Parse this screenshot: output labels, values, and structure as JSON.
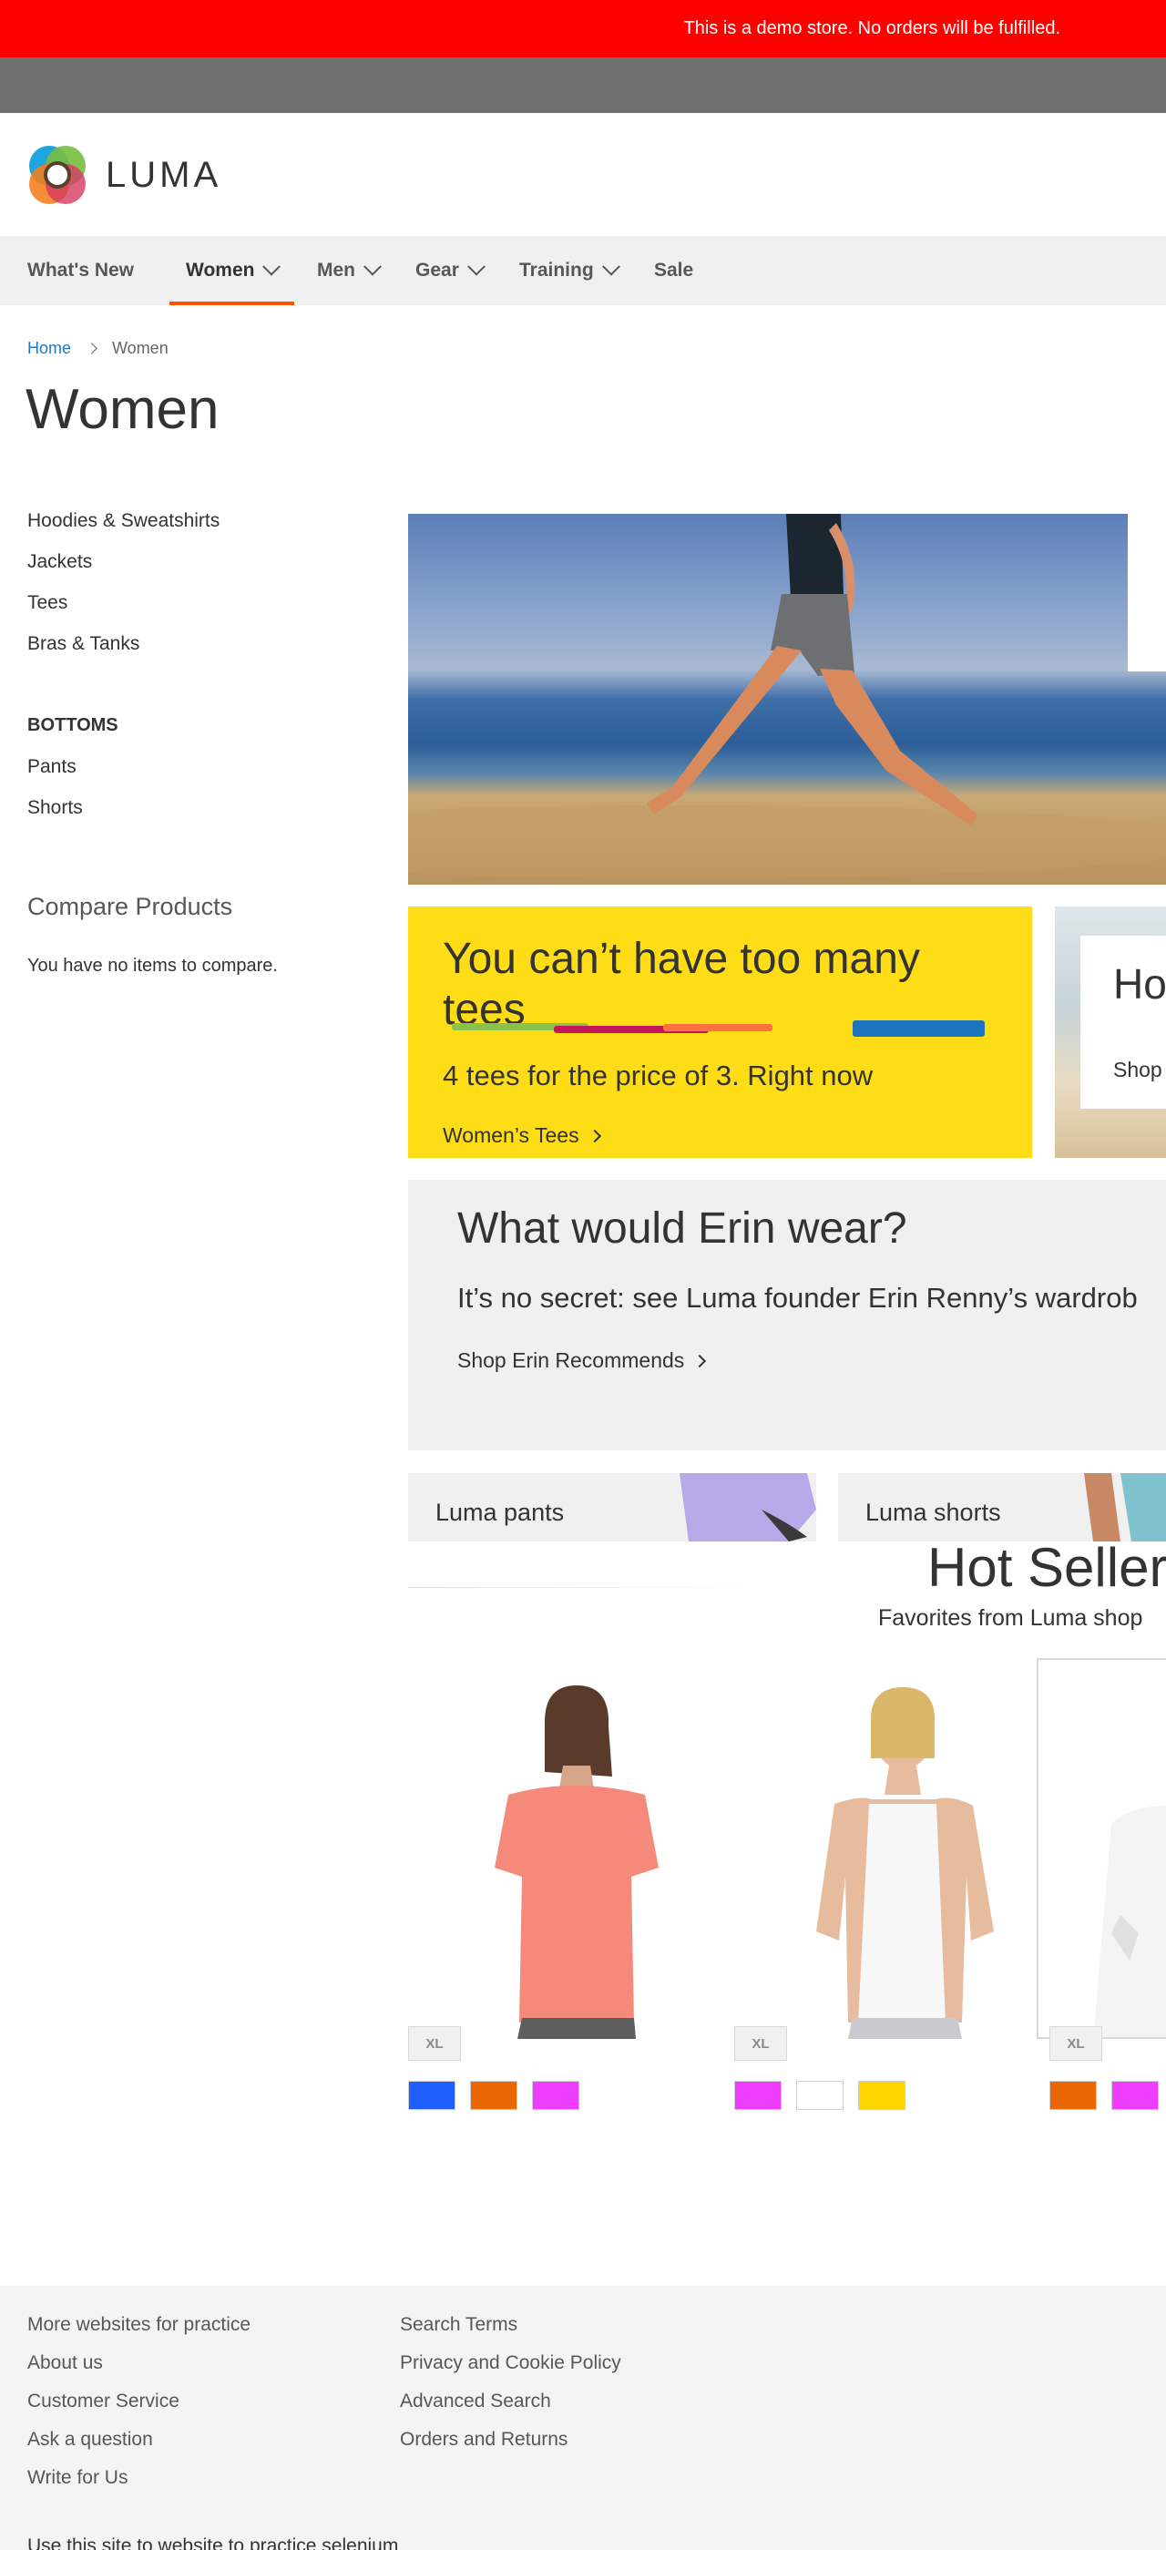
{
  "demo_notice": "This is a demo store. No orders will be fulfilled.",
  "header": {
    "logo_text": "LUMA"
  },
  "nav": {
    "items": [
      {
        "label": "What's New"
      },
      {
        "label": "Women"
      },
      {
        "label": "Men"
      },
      {
        "label": "Gear"
      },
      {
        "label": "Training"
      },
      {
        "label": "Sale"
      }
    ]
  },
  "breadcrumb": {
    "home": "Home",
    "current": "Women"
  },
  "page_title": "Women",
  "sidebar": {
    "tops": [
      "Hoodies & Sweatshirts",
      "Jackets",
      "Tees",
      "Bras & Tanks"
    ],
    "bottoms_heading": "BOTTOMS",
    "bottoms": [
      "Pants",
      "Shorts"
    ],
    "compare_title": "Compare Products",
    "compare_empty": "You have no items to compare."
  },
  "promo_tees": {
    "title": "You can’t have too many tees",
    "subtitle": "4 tees for the price of 3. Right now",
    "link": "Women’s Tees"
  },
  "promo_hoodie": {
    "title": "Ho",
    "link": "Shop"
  },
  "erin": {
    "title": "What would Erin wear?",
    "subtitle": "It’s no secret: see Luma founder Erin Renny’s wardrob",
    "link": "Shop Erin Recommends"
  },
  "tiles": [
    {
      "label": "Luma pants"
    },
    {
      "label": "Luma shorts"
    }
  ],
  "hot_sellers": {
    "title": "Hot Sellers",
    "subtitle": "Favorites from Luma shop"
  },
  "products": [
    {
      "size": "XL",
      "swatches": [
        "#1f5eff",
        "#eb6703",
        "#ef3dff"
      ]
    },
    {
      "size": "XL",
      "swatches": [
        "#ef3dff",
        "#ffffff",
        "#ffd500"
      ]
    },
    {
      "size": "XL",
      "swatches": [
        "#eb6703",
        "#ef3dff"
      ]
    }
  ],
  "footer": {
    "col1": [
      "More websites for practice",
      "About us",
      "Customer Service",
      "Ask a question",
      "Write for Us"
    ],
    "col2": [
      "Search Terms",
      "Privacy and Cookie Policy",
      "Advanced Search",
      "Orders and Returns"
    ],
    "copyright": "Use this site to website to practice selenium"
  },
  "colors": {
    "notice": "#ff0000",
    "accent": "#ff5501",
    "link": "#1979c3",
    "promo": "#ffdd16"
  }
}
